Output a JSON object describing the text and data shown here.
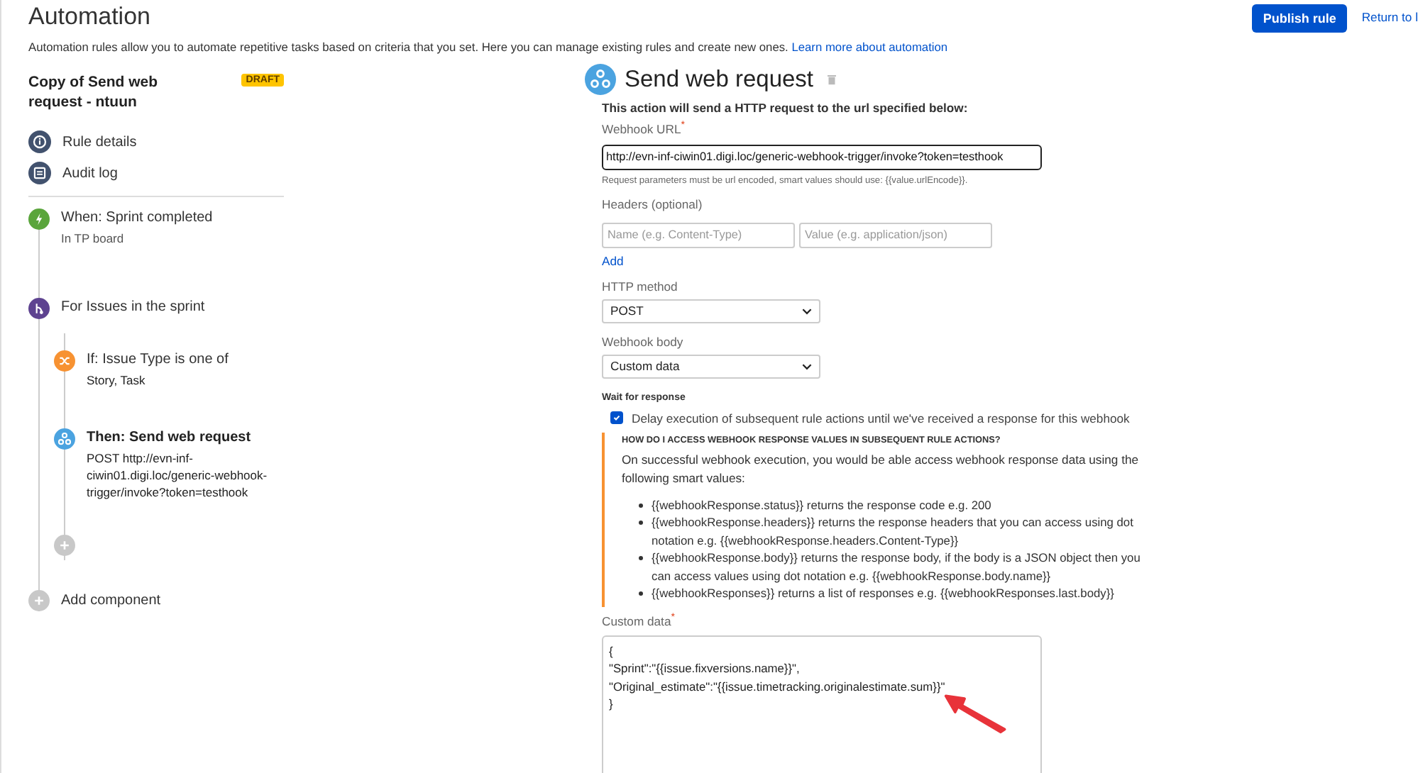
{
  "page": {
    "title": "Automation",
    "description": "Automation rules allow you to automate repetitive tasks based on criteria that you set. Here you can manage existing rules and create new ones.",
    "learn_more_link": "Learn more about automation"
  },
  "header_actions": {
    "publish_button": "Publish rule",
    "return_link": "Return to l"
  },
  "rule": {
    "name": "Copy of Send web request - ntuun",
    "status_badge": "DRAFT"
  },
  "rule_nav": [
    {
      "label": "Rule details",
      "kind": "details"
    },
    {
      "label": "Audit log",
      "kind": "log"
    }
  ],
  "components": [
    {
      "kind": "trigger",
      "title": "When: Sprint completed",
      "subtitle": "In TP board",
      "selected": false
    },
    {
      "kind": "branch",
      "title": "For Issues in the sprint",
      "selected": false,
      "children": [
        {
          "kind": "condition",
          "title": "If: Issue Type is one of",
          "subtitle": "Story, Task",
          "selected": false
        },
        {
          "kind": "action",
          "title": "Then: Send web request",
          "subtitle": "POST http://evn-inf-ciwin01.digi.loc/generic-webhook-trigger/invoke?token=testhook",
          "selected": true
        }
      ]
    }
  ],
  "add_component": "Add component",
  "editor": {
    "title": "Send web request",
    "intro": "This action will send a HTTP request to the url specified below:",
    "url_label": {
      "text": "Webhook URL",
      "required_mark": "*"
    },
    "url_value": "http://evn-inf-ciwin01.digi.loc/generic-webhook-trigger/invoke?token=testhook",
    "url_hint": "Request parameters must be url encoded, smart values should use: {{value.urlEncode}}.",
    "headers_label": "Headers (optional)",
    "header_name_placeholder": "Name (e.g. Content-Type)",
    "header_value_placeholder": "Value (e.g. application/json)",
    "add_link": "Add",
    "method_label": "HTTP method",
    "method_value": "POST",
    "body_label": "Webhook body",
    "body_value": "Custom data",
    "wait_label": "Wait for response",
    "wait_checkbox": {
      "label": "Delay execution of subsequent rule actions until we've received a response for this webhook",
      "checked": true
    },
    "info": {
      "heading": "HOW DO I ACCESS WEBHOOK RESPONSE VALUES IN SUBSEQUENT RULE ACTIONS?",
      "text": "On successful webhook execution, you would be able access webhook response data using the following smart values:",
      "items": [
        "{{webhookResponse.status}} returns the response code e.g. 200",
        "{{webhookResponse.headers}} returns the response headers that you can access using dot notation e.g. {{webhookResponse.headers.Content-Type}}",
        "{{webhookResponse.body}} returns the response body, if the body is a JSON object then you can access values using dot notation e.g. {{webhookResponse.body.name}}",
        "{{webhookResponses}} returns a list of responses e.g. {{webhookResponses.last.body}}"
      ]
    },
    "custom_data_label": {
      "text": "Custom data",
      "required_mark": "*"
    },
    "custom_data_value": "{\n\"Sprint\":\"{{issue.fixversions.name}}\",\n\"Original_estimate\":\"{{issue.timetracking.originalestimate.sum}}\"\n}"
  }
}
